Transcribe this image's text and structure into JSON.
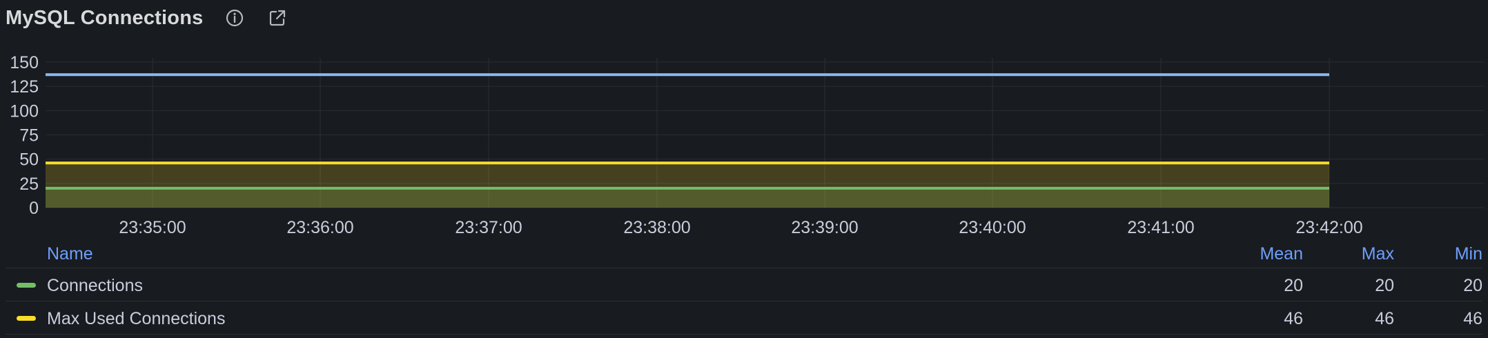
{
  "panel": {
    "title": "MySQL Connections",
    "icons": [
      "info-icon",
      "external-link-icon"
    ]
  },
  "chart_data": {
    "type": "line",
    "x": [
      "23:35:00",
      "23:36:00",
      "23:37:00",
      "23:38:00",
      "23:39:00",
      "23:40:00",
      "23:41:00",
      "23:42:00"
    ],
    "y_ticks": [
      "150",
      "125",
      "100",
      "75",
      "50",
      "25",
      "0"
    ],
    "ylim": [
      0,
      150
    ],
    "grid": true,
    "series": [
      {
        "name": "Connections",
        "value": 20,
        "color": "#73bf69",
        "fill": true
      },
      {
        "name": "Max Used Connections",
        "value": 46,
        "color": "#fade2a",
        "fill": true
      },
      {
        "value": 137,
        "color": "#8ab8ff",
        "fill": false
      }
    ]
  },
  "legend": {
    "headers": {
      "name": "Name",
      "mean": "Mean",
      "max": "Max",
      "min": "Min"
    },
    "rows": [
      {
        "name": "Connections",
        "color": "#73bf69",
        "mean": "20",
        "max": "20",
        "min": "20"
      },
      {
        "name": "Max Used Connections",
        "color": "#fade2a",
        "mean": "46",
        "max": "46",
        "min": "46"
      }
    ]
  }
}
